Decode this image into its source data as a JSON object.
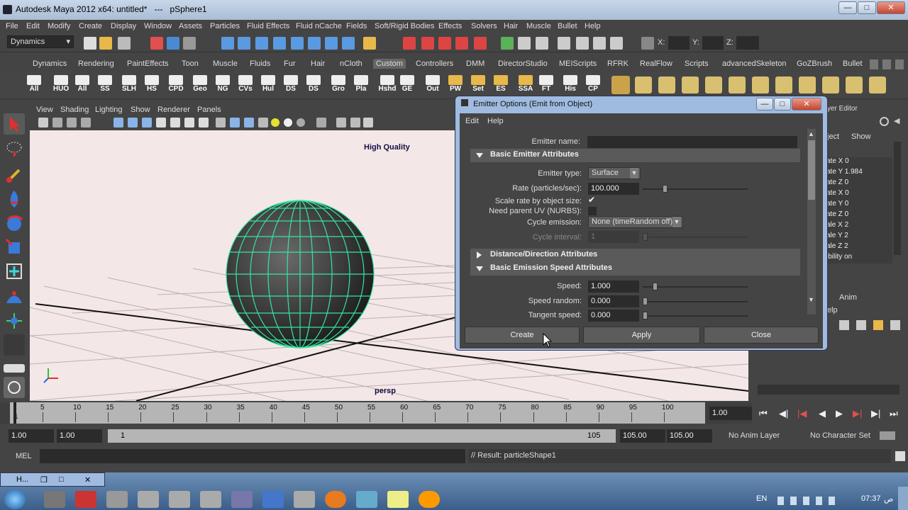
{
  "window": {
    "app_title": "Autodesk Maya 2012 x64: untitled*",
    "separator": "---",
    "selection": "pSphere1"
  },
  "menus": [
    "File",
    "Edit",
    "Modify",
    "Create",
    "Display",
    "Window",
    "Assets",
    "Particles",
    "Fluid Effects",
    "Fluid nCache",
    "Fields",
    "Soft/Rigid Bodies",
    "Effects",
    "Solvers",
    "Hair",
    "Muscle",
    "Bullet",
    "Help"
  ],
  "status_line": {
    "menu_set": "Dynamics",
    "x_label": "X:",
    "y_label": "Y:",
    "z_label": "Z:"
  },
  "shelf_tabs": [
    "Dynamics",
    "Rendering",
    "PaintEffects",
    "Toon",
    "Muscle",
    "Fluids",
    "Fur",
    "Hair",
    "nCloth",
    "Custom",
    "Controllers",
    "DMM",
    "DirectorStudio",
    "MEIScripts",
    "RFRK",
    "RealFlow",
    "Scripts",
    "advancedSkeleton",
    "GoZBrush",
    "Bullet"
  ],
  "active_shelf_tab": "Custom",
  "shelf_buttons": [
    "All",
    "HUO",
    "All",
    "SS",
    "SLH",
    "HS",
    "CPD",
    "Geo",
    "NG",
    "CVs",
    "Hul",
    "DS",
    "DS",
    "Gro",
    "Pla",
    "Hshd",
    "GE",
    "Out",
    "PW",
    "Set",
    "ES",
    "SSA",
    "FT",
    "His",
    "CP"
  ],
  "panel_menu": [
    "View",
    "Shading",
    "Lighting",
    "Show",
    "Renderer",
    "Panels"
  ],
  "viewport": {
    "hud_quality": "High Quality",
    "camera": "persp",
    "bg_color": "#f4e7e7",
    "wire_color": "#33e6a0"
  },
  "channel_box": {
    "menu": [
      "ject",
      "Show"
    ],
    "header": "yer Editor",
    "rows": [
      "ate X 0",
      "ate Y 1.984",
      "ate Z 0",
      "ate X 0",
      "ate Y 0",
      "ate Z 0",
      "ale X 2",
      "ale Y 2",
      "ale Z 2",
      "ibility on"
    ],
    "tab_anim": "Anim",
    "help": "elp"
  },
  "dialog": {
    "title": "Emitter Options (Emit from Object)",
    "menu": [
      "Edit",
      "Help"
    ],
    "emitter_name_label": "Emitter name:",
    "emitter_name_value": "",
    "sections": {
      "basic": "Basic Emitter Attributes",
      "direction": "Distance/Direction Attributes",
      "speed": "Basic Emission Speed Attributes"
    },
    "emitter_type_label": "Emitter type:",
    "emitter_type_value": "Surface",
    "rate_label": "Rate (particles/sec):",
    "rate_value": "100.000",
    "scale_rate_label": "Scale rate by object size:",
    "scale_rate_checked": true,
    "need_uv_label": "Need parent UV (NURBS):",
    "need_uv_checked": false,
    "cycle_label": "Cycle emission:",
    "cycle_value": "None (timeRandom off)",
    "cycle_interval_label": "Cycle interval:",
    "cycle_interval_value": "1",
    "speed_label": "Speed:",
    "speed_value": "1.000",
    "speed_random_label": "Speed random:",
    "speed_random_value": "0.000",
    "tangent_label": "Tangent speed:",
    "tangent_value": "0.000",
    "buttons": {
      "create": "Create",
      "apply": "Apply",
      "close": "Close"
    }
  },
  "timeline": {
    "ticks": [
      "5",
      "10",
      "15",
      "20",
      "25",
      "30",
      "35",
      "40",
      "45",
      "50",
      "55",
      "60",
      "65",
      "70",
      "75",
      "80",
      "85",
      "90",
      "95",
      "100"
    ],
    "start": "1",
    "end_tick": "10",
    "current_frame": "1.00"
  },
  "range": {
    "start": "1.00",
    "playback_start": "1.00",
    "range_start": "1",
    "range_end": "105",
    "playback_end": "105.00",
    "end": "105.00",
    "anim_layer": "No Anim Layer",
    "char_set": "No Character Set"
  },
  "command_line": {
    "label": "MEL",
    "result": "// Result: particleShape1"
  },
  "taskbar": {
    "lang": "EN",
    "time": "07:37",
    "ampm": "ص",
    "maya_item": "H..."
  }
}
